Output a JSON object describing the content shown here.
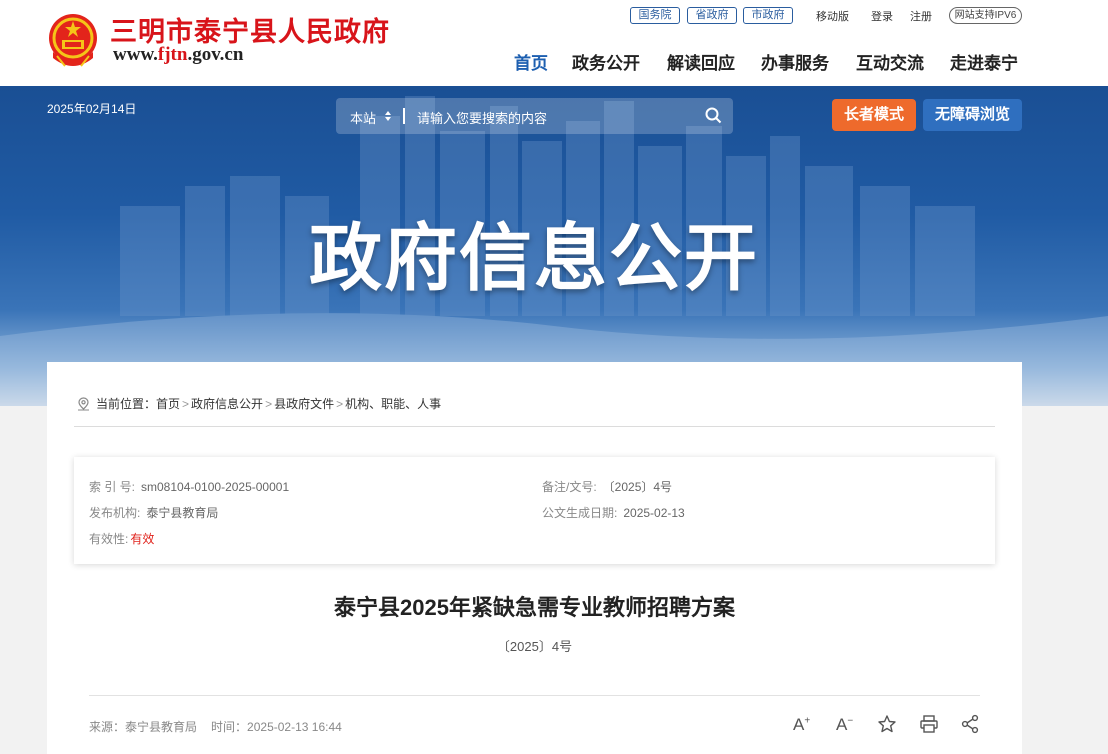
{
  "header": {
    "site_title": "三明市泰宁县人民政府",
    "domain_prefix": "www.",
    "domain_accent": "fjtn",
    "domain_suffix": ".gov.cn",
    "top_tags": [
      "国务院",
      "省政府",
      "市政府"
    ],
    "util_links": [
      "移动版",
      "登录",
      "注册"
    ],
    "ipv6_badge": "网站支持IPV6",
    "nav": [
      {
        "label": "首页",
        "active": true
      },
      {
        "label": "政务公开",
        "active": false
      },
      {
        "label": "解读回应",
        "active": false
      },
      {
        "label": "办事服务",
        "active": false
      },
      {
        "label": "互动交流",
        "active": false
      },
      {
        "label": "走进泰宁",
        "active": false
      }
    ]
  },
  "banner": {
    "date": "2025年02月14日",
    "search_scope": "本站",
    "search_placeholder": "请输入您要搜索的内容",
    "elder_mode": "长者模式",
    "accessible": "无障碍浏览",
    "title": "政府信息公开"
  },
  "breadcrumb": {
    "label": "当前位置：",
    "items": [
      "首页",
      "政府信息公开",
      "县政府文件",
      "机构、职能、人事"
    ],
    "separator": ">"
  },
  "meta": {
    "index_label": "索 引 号:",
    "index_value": "sm08104-0100-2025-00001",
    "issuer_label": "发布机构:",
    "issuer_value": "泰宁县教育局",
    "validity_label": "有效性:",
    "validity_value": "有效",
    "docno_label": "备注/文号:",
    "docno_value": "〔2025〕4号",
    "gen_date_label": "公文生成日期:",
    "gen_date_value": "2025-02-13"
  },
  "article": {
    "title": "泰宁县2025年紧缺急需专业教师招聘方案",
    "doc_number": "〔2025〕4号",
    "source_label": "来源：",
    "source_value": "泰宁县教育局",
    "time_label": "时间：",
    "time_value": "2025-02-13 16:44"
  },
  "tools": {
    "font_up": "A",
    "font_down": "A",
    "icons": [
      "font-increase-icon",
      "font-decrease-icon",
      "star-icon",
      "print-icon",
      "share-icon"
    ]
  },
  "colors": {
    "brand_red": "#d8141a",
    "nav_blue": "#1d5fb0",
    "elder_orange": "#ee6a2c",
    "access_blue": "#2f6fbf",
    "validity_red": "#e0231c"
  }
}
